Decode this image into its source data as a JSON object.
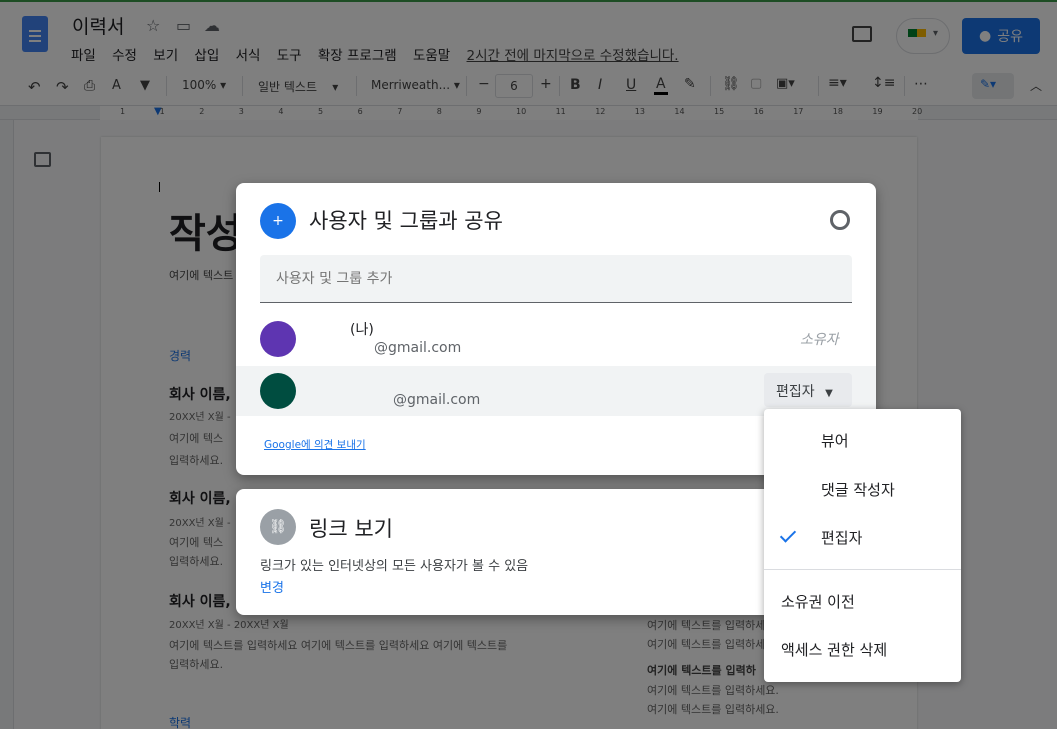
{
  "app": {
    "doc_title": "이력서",
    "menu": [
      "파일",
      "수정",
      "보기",
      "삽입",
      "서식",
      "도구",
      "확장 프로그램",
      "도움말"
    ],
    "last_edit": "2시간 전에 마지막으로 수정했습니다.",
    "share_label": "공유"
  },
  "toolbar": {
    "zoom": "100%",
    "style": "일반 텍스트",
    "font": "Merriweath...",
    "font_size": "6",
    "minus": "−",
    "plus": "+",
    "bold": "B",
    "italic": "I",
    "underline": "U",
    "text_color": "A",
    "more": "⋯"
  },
  "ruler": [
    "1",
    "1",
    "2",
    "3",
    "4",
    "5",
    "6",
    "7",
    "8",
    "9",
    "10",
    "11",
    "12",
    "13",
    "14",
    "15",
    "16",
    "17",
    "18",
    "19",
    "20"
  ],
  "document": {
    "heading": "작성",
    "intro": "여기에 텍스트",
    "section_career": "경력",
    "company": "회사 이름,",
    "date": "20XX년 X월 - 20XX년 X월",
    "date_short": "20XX년 X월 -",
    "line1": "여기에 텍스트를 입력하세요 여기에 텍스트를 입력하세요 여기에 텍스트를",
    "line1_short": "여기에 텍스",
    "line2": "입력하세요.",
    "side_lines": [
      "여기에 텍스트를 입력하세요.",
      "여기에 텍스트를 입력하세요.",
      "여기에 텍스트를 입력하세요.",
      "여기에 텍스트를 입력하세요.",
      "여기에 텍스트를 입력하세요."
    ],
    "side_bold": "여기에 텍스트를 입력하",
    "section_edu": "학력"
  },
  "share_dialog": {
    "title": "사용자 및 그룹과 공유",
    "add_placeholder": "사용자 및 그룹 추가",
    "owner_tag": "(나)",
    "owner_email": "@gmail.com",
    "owner_role": "소유자",
    "user_email": "@gmail.com",
    "user_role": "편집자",
    "feedback_link": "Google에 의견 보내기"
  },
  "link_dialog": {
    "title": "링크 보기",
    "description": "링크가 있는 인터넷상의 모든 사용자가 볼 수 있음",
    "change": "변경"
  },
  "role_menu": {
    "items": [
      "뷰어",
      "댓글 작성자",
      "편집자"
    ],
    "selected": "편집자",
    "transfer": "소유권 이전",
    "remove": "액세스 권한 삭제"
  },
  "colors": {
    "accent": "#1a73e8",
    "owner_avatar": "#5e35b1",
    "user_avatar": "#004d40"
  }
}
